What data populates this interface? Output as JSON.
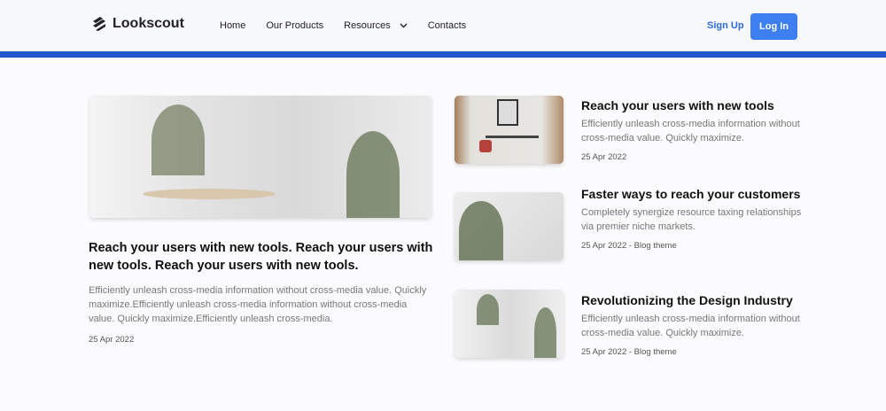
{
  "header": {
    "brand": "Lookscout",
    "nav": [
      "Home",
      "Our Products",
      "Resources",
      "Contacts"
    ],
    "signup": "Sign Up",
    "login": "Log In"
  },
  "featured": {
    "title": "Reach your users with new tools. Reach your users with new tools. Reach your users with new tools.",
    "excerpt": "Efficiently unleash cross-media information without cross-media value. Quickly maximize.Efficiently unleash cross-media information without cross-media value. Quickly maximize.Efficiently unleash cross-media.",
    "date": "25 Apr 2022"
  },
  "articles": [
    {
      "title": "Reach your users with new tools",
      "excerpt": "Efficiently unleash cross-media information without cross-media value. Quickly maximize.",
      "date": "25 Apr 2022"
    },
    {
      "title": "Faster ways to reach your customers",
      "excerpt": "Completely synergize resource taxing relationships via premier niche markets.",
      "date": "25 Apr 2022 - Blog theme"
    },
    {
      "title": "Revolutionizing the Design Industry",
      "excerpt": "Efficiently unleash cross-media information without cross-media value. Quickly maximize.",
      "date": "25 Apr 2022 - Blog theme"
    }
  ]
}
